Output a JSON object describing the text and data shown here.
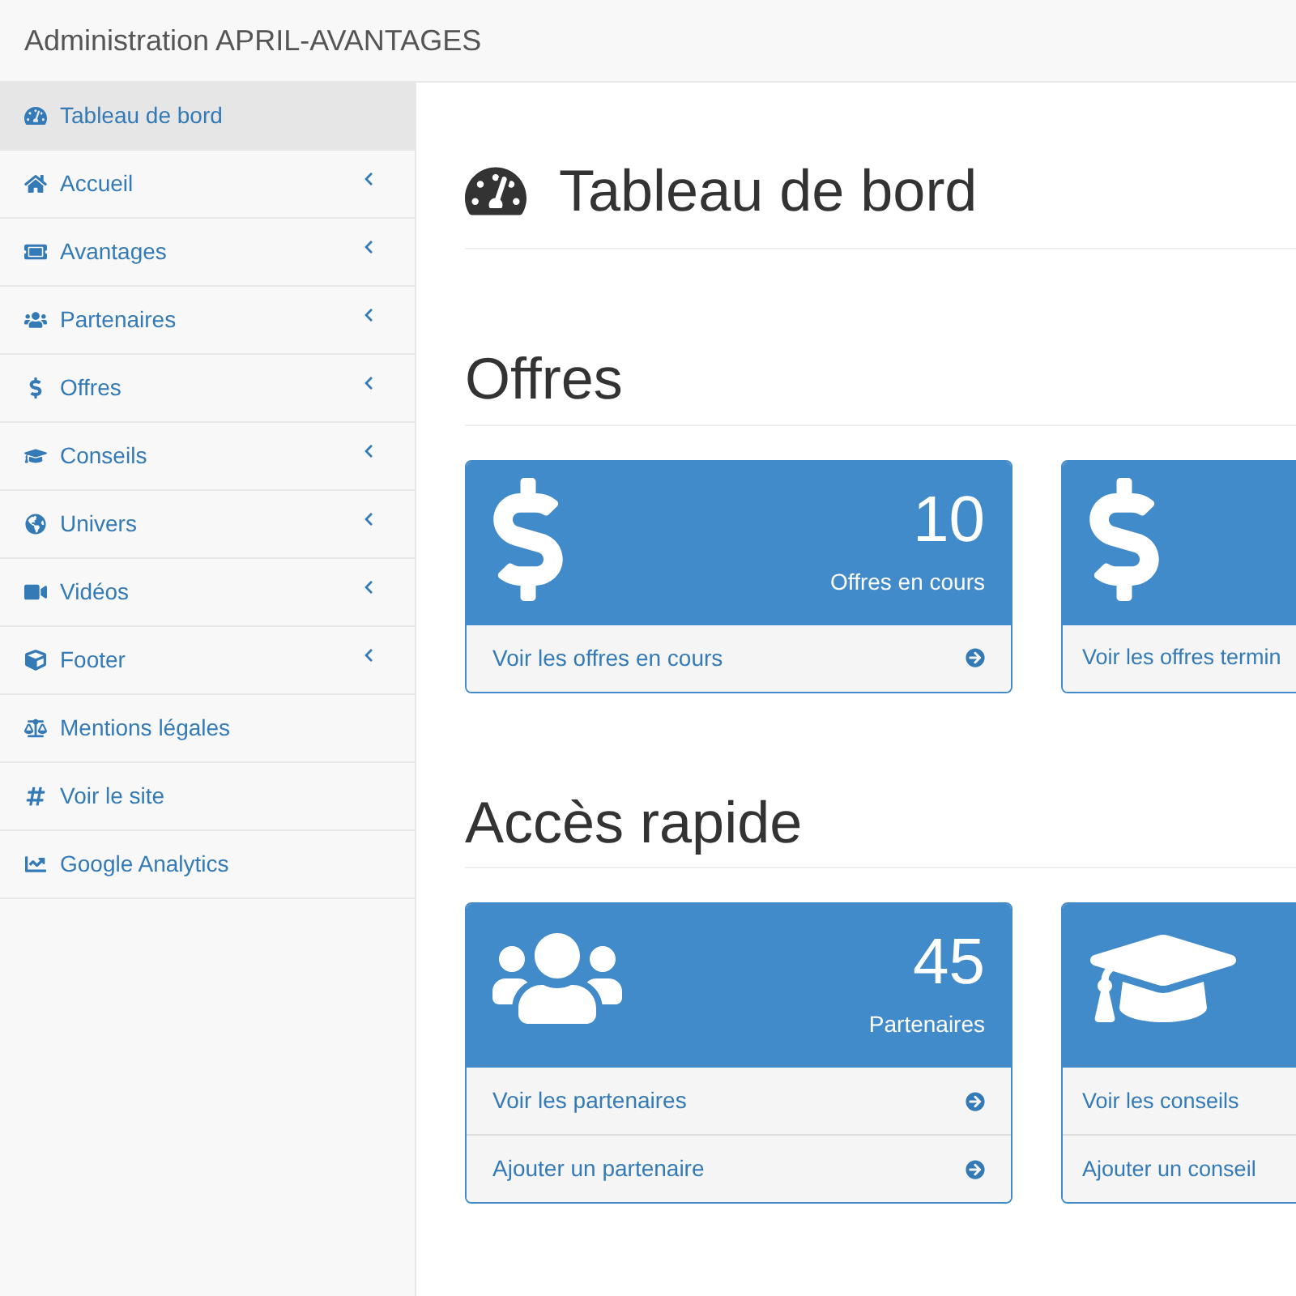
{
  "navbar": {
    "brand": "Administration APRIL-AVANTAGES"
  },
  "sidebar": {
    "items": [
      {
        "label": "Tableau de bord",
        "selected": true,
        "kind": "link"
      },
      {
        "label": "Accueil",
        "selected": false,
        "kind": "submenu"
      },
      {
        "label": "Avantages",
        "selected": false,
        "kind": "submenu"
      },
      {
        "label": "Partenaires",
        "selected": false,
        "kind": "submenu"
      },
      {
        "label": "Offres",
        "selected": false,
        "kind": "submenu"
      },
      {
        "label": "Conseils",
        "selected": false,
        "kind": "submenu"
      },
      {
        "label": "Univers",
        "selected": false,
        "kind": "submenu"
      },
      {
        "label": "Vidéos",
        "selected": false,
        "kind": "submenu"
      },
      {
        "label": "Footer",
        "selected": false,
        "kind": "submenu"
      },
      {
        "label": "Mentions légales",
        "selected": false,
        "kind": "link"
      },
      {
        "label": "Voir le site",
        "selected": false,
        "kind": "link"
      },
      {
        "label": "Google Analytics",
        "selected": false,
        "kind": "link"
      }
    ]
  },
  "page_title": "Tableau de bord",
  "sections": [
    {
      "title": "Offres",
      "panels": [
        {
          "kind": "dollar",
          "count": "10",
          "caption": "Offres en cours",
          "links": [
            {
              "label": "Voir les offres en cours",
              "arrow": true
            }
          ]
        },
        {
          "kind": "dollar",
          "links": [
            {
              "label": "Voir les offres termin"
            }
          ]
        }
      ]
    },
    {
      "title": "Accès rapide",
      "panels": [
        {
          "kind": "users",
          "count": "45",
          "caption": "Partenaires",
          "links": [
            {
              "label": "Voir les partenaires",
              "arrow": true
            },
            {
              "label": "Ajouter un partenaire",
              "arrow": true
            }
          ]
        },
        {
          "kind": "cap",
          "links": [
            {
              "label": "Voir les conseils"
            },
            {
              "label": "Ajouter un conseil"
            }
          ]
        }
      ]
    }
  ]
}
